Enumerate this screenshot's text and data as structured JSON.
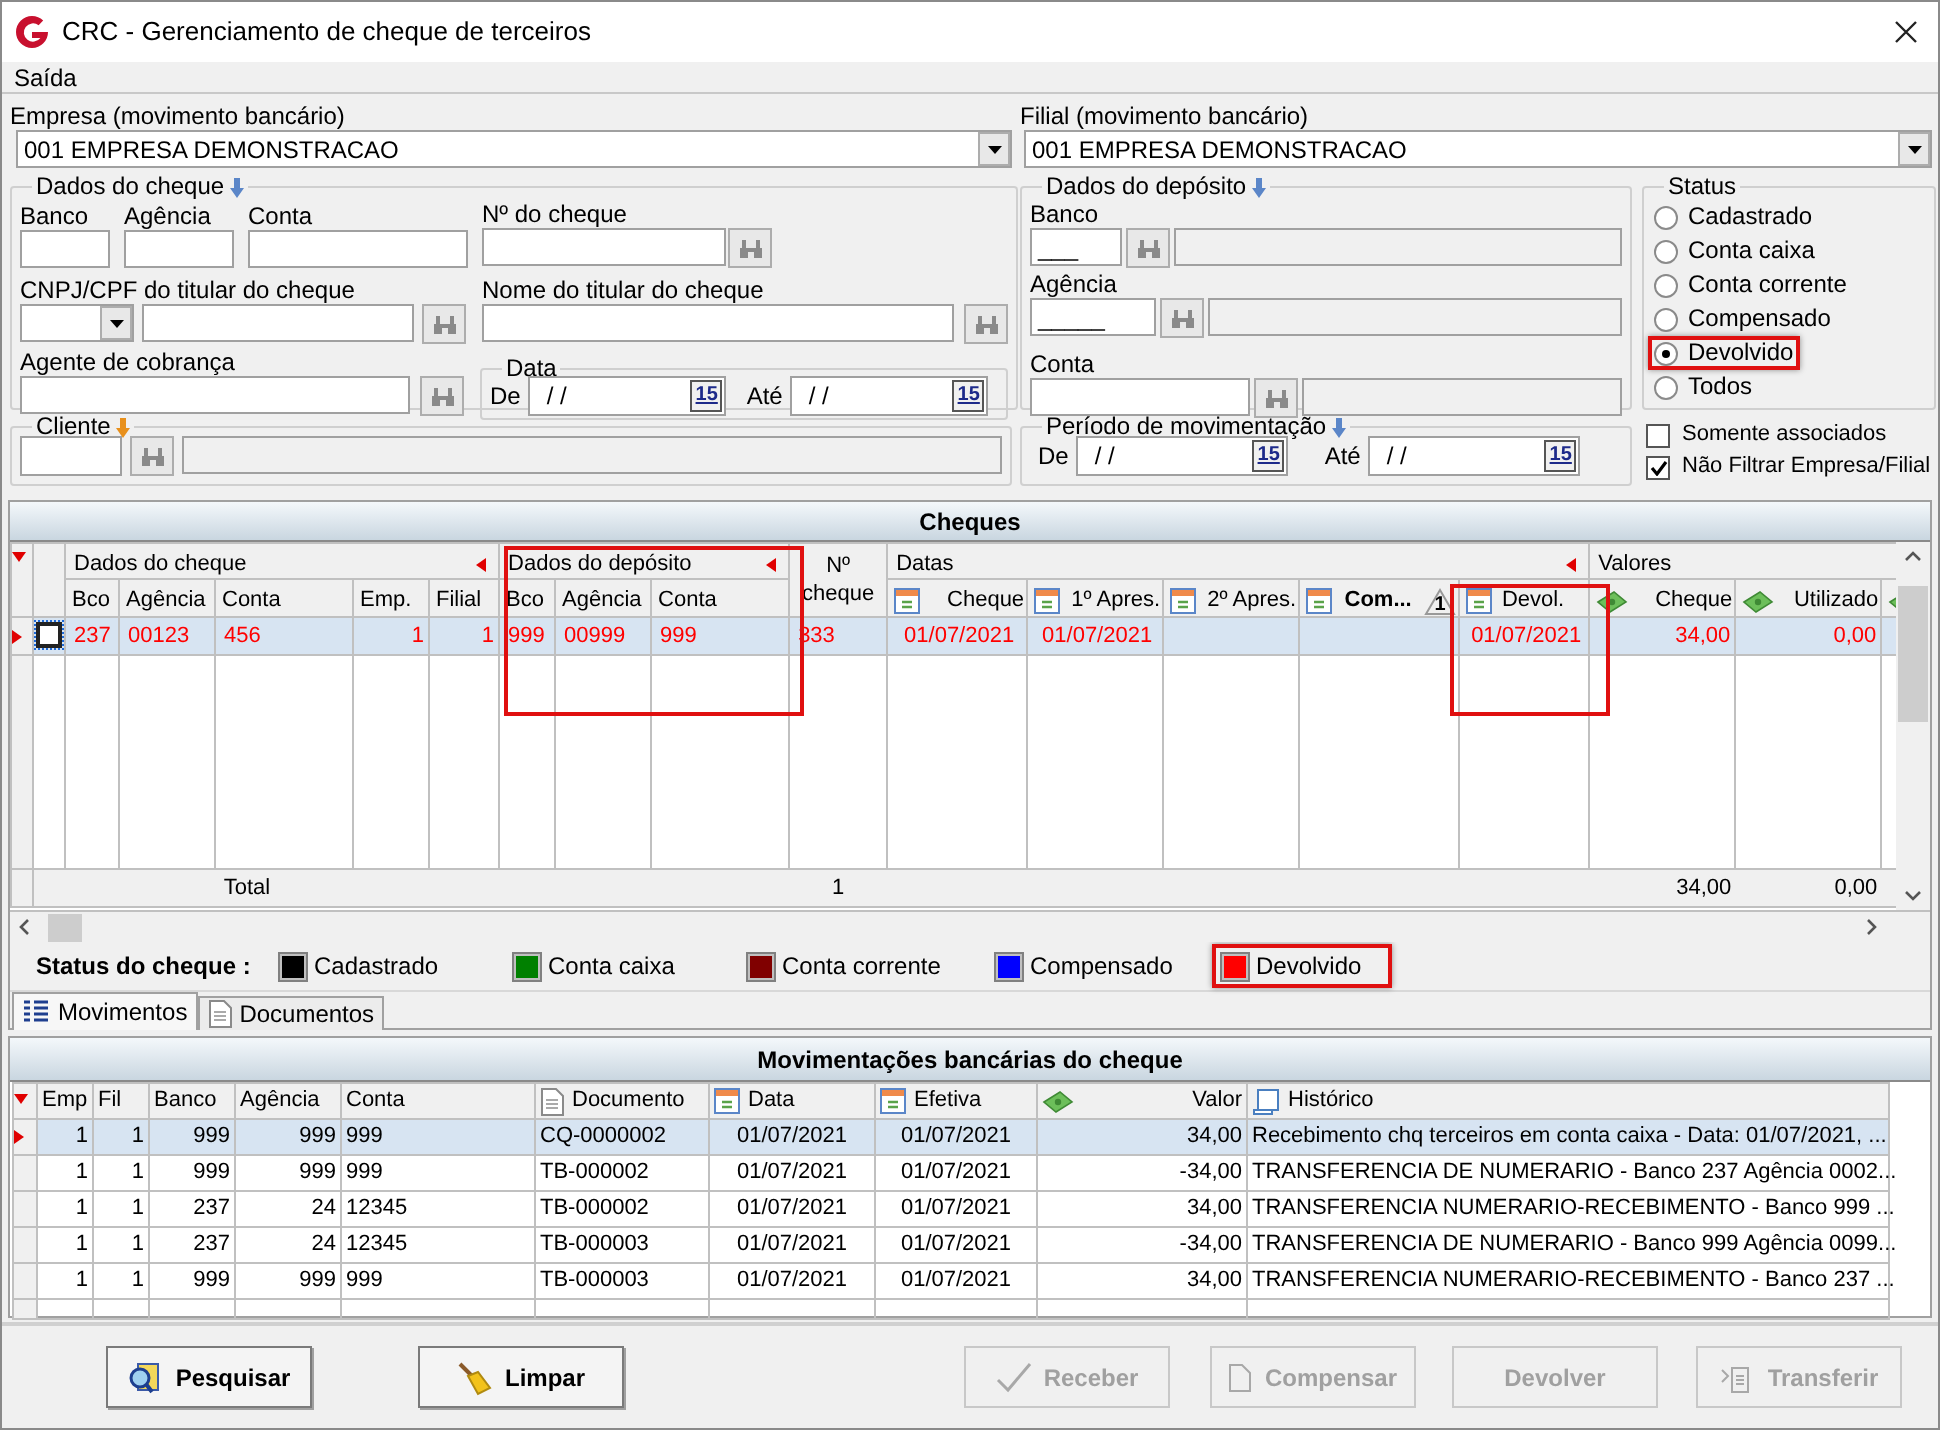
{
  "window": {
    "title": "CRC - Gerenciamento de cheque de terceiros"
  },
  "menu": [
    {
      "label": "Saída"
    }
  ],
  "empresa": {
    "label": "Empresa (movimento bancário)",
    "value": "001 EMPRESA DEMONSTRACAO"
  },
  "filial": {
    "label": "Filial (movimento bancário)",
    "value": "001 EMPRESA DEMONSTRACAO"
  },
  "dados_cheque": {
    "title": "Dados do cheque",
    "color": "#5b86c8",
    "banco": {
      "label": "Banco"
    },
    "agencia": {
      "label": "Agência"
    },
    "conta": {
      "label": "Conta"
    },
    "numero": {
      "label": "Nº do cheque"
    },
    "cnpj": {
      "label": "CNPJ/CPF do titular do cheque"
    },
    "nome": {
      "label": "Nome do titular do cheque"
    },
    "agente": {
      "label": "Agente de cobrança"
    },
    "data": {
      "title": "Data",
      "dates": [
        {
          "label": "De",
          "value": "/ /",
          "button": "15"
        },
        {
          "label": "Até",
          "value": "/ /",
          "button": "15"
        }
      ]
    }
  },
  "dados_deposito": {
    "title": "Dados do depósito",
    "color": "#5b86c8",
    "banco": {
      "label": "Banco",
      "value": "___"
    },
    "agencia": {
      "label": "Agência",
      "value": "_____"
    },
    "conta": {
      "label": "Conta"
    }
  },
  "status": {
    "title": "Status",
    "options": [
      {
        "label": "Cadastrado",
        "selected": false,
        "highlighted": false
      },
      {
        "label": "Conta caixa",
        "selected": false,
        "highlighted": false
      },
      {
        "label": "Conta corrente",
        "selected": false,
        "highlighted": false
      },
      {
        "label": "Compensado",
        "selected": false,
        "highlighted": false
      },
      {
        "label": "Devolvido",
        "selected": true,
        "highlighted": true
      },
      {
        "label": "Todos",
        "selected": false,
        "highlighted": false
      }
    ]
  },
  "cliente": {
    "title": "Cliente",
    "color": "#e8901c"
  },
  "periodo": {
    "title": "Período de movimentação",
    "color": "#5b86c8",
    "dates": [
      {
        "label": "De",
        "value": "/ /",
        "button": "15"
      },
      {
        "label": "Até",
        "value": "/ /",
        "button": "15"
      }
    ]
  },
  "options": [
    {
      "label": "Somente associados",
      "checked": false
    },
    {
      "label": "Não Filtrar Empresa/Filial",
      "checked": true
    }
  ],
  "cheques": {
    "title": "Cheques",
    "groups": [
      {
        "label": "Dados do cheque",
        "collapsible": true,
        "highlighted": false,
        "columns": [
          {
            "label": "Bco"
          },
          {
            "label": "Agência"
          },
          {
            "label": "Conta"
          },
          {
            "label": "Emp."
          },
          {
            "label": "Filial"
          }
        ]
      },
      {
        "label": "Dados do depósito",
        "collapsible": true,
        "highlighted": true,
        "columns": [
          {
            "label": "Bco"
          },
          {
            "label": "Agência"
          },
          {
            "label": "Conta"
          }
        ]
      },
      {
        "columns": [
          {
            "label": "Nº cheque"
          }
        ]
      },
      {
        "label": "Datas",
        "collapsible": true,
        "highlighted": false,
        "columns": [
          {
            "label": "Cheque",
            "kind": "date"
          },
          {
            "label": "1º Apres.",
            "kind": "date"
          },
          {
            "label": "2º Apres.",
            "kind": "date"
          },
          {
            "label": "Com...",
            "kind": "date",
            "sort_mark": "1"
          },
          {
            "label": "Devol.",
            "kind": "date",
            "highlighted": true
          }
        ]
      },
      {
        "label": "Valores",
        "collapsible": false,
        "highlighted": false,
        "columns": [
          {
            "label": "Cheque",
            "kind": "amount"
          },
          {
            "label": "Utilizado",
            "kind": "amount"
          },
          {
            "kind": "amount"
          }
        ]
      }
    ],
    "rows": [
      {
        "selected": true,
        "checked": false,
        "color": "#ff0000",
        "cells": [
          "237",
          "00123",
          "456",
          "1",
          "1",
          "999",
          "00999",
          "999",
          "333",
          "01/07/2021",
          "01/07/2021",
          null,
          null,
          "01/07/2021",
          "34,00",
          "0,00",
          null
        ]
      }
    ],
    "totals": {
      "label": "Total",
      "count": "1",
      "values": [
        "34,00",
        "0,00"
      ]
    }
  },
  "legend": {
    "title": "Status do cheque :",
    "items": [
      {
        "label": "Cadastrado",
        "color": "#000000",
        "highlighted": false
      },
      {
        "label": "Conta caixa",
        "color": "#008000",
        "highlighted": false
      },
      {
        "label": "Conta corrente",
        "color": "#800000",
        "highlighted": false
      },
      {
        "label": "Compensado",
        "color": "#0000ff",
        "highlighted": false
      },
      {
        "label": "Devolvido",
        "color": "#ff0000",
        "highlighted": true
      }
    ]
  },
  "tabs": [
    {
      "label": "Movimentos",
      "kind": "list",
      "selected": true
    },
    {
      "label": "Documentos",
      "kind": "document",
      "selected": false
    }
  ],
  "movimentacoes": {
    "title": "Movimentações bancárias do cheque",
    "columns": [
      {
        "label": "Emp"
      },
      {
        "label": "Fil"
      },
      {
        "label": "Banco"
      },
      {
        "label": "Agência"
      },
      {
        "label": "Conta"
      },
      {
        "label": "Documento",
        "kind": "document"
      },
      {
        "label": "Data",
        "kind": "date"
      },
      {
        "label": "Efetiva",
        "kind": "date"
      },
      {
        "label": "Valor",
        "kind": "amount"
      },
      {
        "label": "Histórico",
        "kind": "notes"
      }
    ],
    "rows": [
      {
        "selected": true,
        "cells": [
          "1",
          "1",
          "999",
          "999",
          "999",
          "CQ-0000002",
          "01/07/2021",
          "01/07/2021",
          "34,00",
          "Recebimento chq terceiros em conta caixa - Data: 01/07/2021, ..."
        ]
      },
      {
        "selected": false,
        "cells": [
          "1",
          "1",
          "999",
          "999",
          "999",
          "TB-000002",
          "01/07/2021",
          "01/07/2021",
          "-34,00",
          "TRANSFERENCIA DE NUMERARIO - Banco 237 Agência 0002..."
        ]
      },
      {
        "selected": false,
        "cells": [
          "1",
          "1",
          "237",
          "24",
          "12345",
          "TB-000002",
          "01/07/2021",
          "01/07/2021",
          "34,00",
          "TRANSFERENCIA NUMERARIO-RECEBIMENTO - Banco 999 ..."
        ]
      },
      {
        "selected": false,
        "cells": [
          "1",
          "1",
          "237",
          "24",
          "12345",
          "TB-000003",
          "01/07/2021",
          "01/07/2021",
          "-34,00",
          "TRANSFERENCIA DE NUMERARIO - Banco 999 Agência 0099..."
        ]
      },
      {
        "selected": false,
        "cells": [
          "1",
          "1",
          "999",
          "999",
          "999",
          "TB-000003",
          "01/07/2021",
          "01/07/2021",
          "34,00",
          "TRANSFERENCIA NUMERARIO-RECEBIMENTO - Banco 237 ..."
        ]
      }
    ]
  },
  "buttons": [
    {
      "label": "Pesquisar",
      "kind": "search",
      "disabled": false
    },
    {
      "label": "Limpar",
      "kind": "clear",
      "disabled": false
    },
    {
      "label": "Receber",
      "kind": "receive",
      "disabled": true
    },
    {
      "label": "Compensar",
      "kind": "compensate",
      "disabled": true
    },
    {
      "label": "Devolver",
      "kind": "return",
      "disabled": true
    },
    {
      "label": "Transferir",
      "kind": "transfer",
      "disabled": true
    }
  ]
}
